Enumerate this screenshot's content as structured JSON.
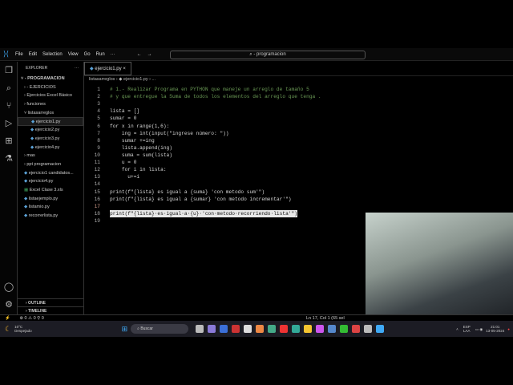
{
  "titlebar": {
    "menu": [
      "File",
      "Edit",
      "Selection",
      "View",
      "Go",
      "Run",
      "···"
    ],
    "nav_back": "←",
    "nav_fwd": "→",
    "search": "⌕ - programacion"
  },
  "sidebar": {
    "title": "EXPLORER",
    "more": "···",
    "root": "˅ - PROGRAMACION",
    "items": [
      {
        "label": "› - EJERCICIOS",
        "type": "folder",
        "indent": 1
      },
      {
        "label": "› Ejercicios Excel Básico",
        "type": "folder",
        "indent": 1
      },
      {
        "label": "› funciones",
        "type": "folder",
        "indent": 1
      },
      {
        "label": "˅ listasarreglos",
        "type": "folder",
        "indent": 1
      },
      {
        "label": "ejercicio1.py",
        "type": "py",
        "indent": 2,
        "selected": true
      },
      {
        "label": "ejercicio2.py",
        "type": "py",
        "indent": 2
      },
      {
        "label": "ejercicio3.py",
        "type": "py",
        "indent": 2
      },
      {
        "label": "ejercicio4.py",
        "type": "py",
        "indent": 2
      },
      {
        "label": "› mas",
        "type": "folder",
        "indent": 1
      },
      {
        "label": "› ppt programacion",
        "type": "folder",
        "indent": 1
      },
      {
        "label": "ejercicio1 candidatos...",
        "type": "py",
        "indent": 1
      },
      {
        "label": "ejercicio4.py",
        "type": "py",
        "indent": 1
      },
      {
        "label": "Excel Clase 3.xls",
        "type": "xls",
        "indent": 1
      },
      {
        "label": "listaejemplo.py",
        "type": "py",
        "indent": 1
      },
      {
        "label": "listamio.py",
        "type": "py",
        "indent": 1
      },
      {
        "label": "recorrerlista.py",
        "type": "py",
        "indent": 1
      }
    ],
    "outline": "› OUTLINE",
    "timeline": "› TIMELINE"
  },
  "editor": {
    "tab": "ejercicio1.py",
    "tab_close": "×",
    "breadcrumb": "listasarreglos › ◆ ejercicio1.py › ...",
    "lines": [
      "# 1.- Realizar Programa en PYTHON que maneje un arreglo de tamaño 5",
      "# y que entregue la Suma de todos los elementos del arreglo que tenga .",
      "",
      "lista = []",
      "sumar = 0",
      "for x in range(1,6):",
      "    ing = int(input(\"ingrese número: \"))",
      "    sumar +=ing",
      "    lista.append(ing)",
      "    suma = sum(lista)",
      "    u = 0",
      "    for i in lista:",
      "      u+=i",
      "",
      "print(f\"{lista} es igual a {suma} 'con metodo sum'\")",
      "print(f\"{lista} es igual a {sumar} 'con metodo incrementar'\")",
      "",
      "print(f\"{lista}·es·igual·a·{u}·'con·metodo·recorriendo·lista'\")",
      ""
    ]
  },
  "status": {
    "left": "⊗ 0 ⚠ 0   ⚲ 0",
    "position": "Ln 17, Col 1 (65 sel"
  },
  "taskbar": {
    "weather_temp": "10°C",
    "weather_desc": "Despejado",
    "search": "Buscar",
    "lang": "ESP",
    "lang2": "LAA",
    "time": "21:01",
    "date": "13-05-2024"
  }
}
